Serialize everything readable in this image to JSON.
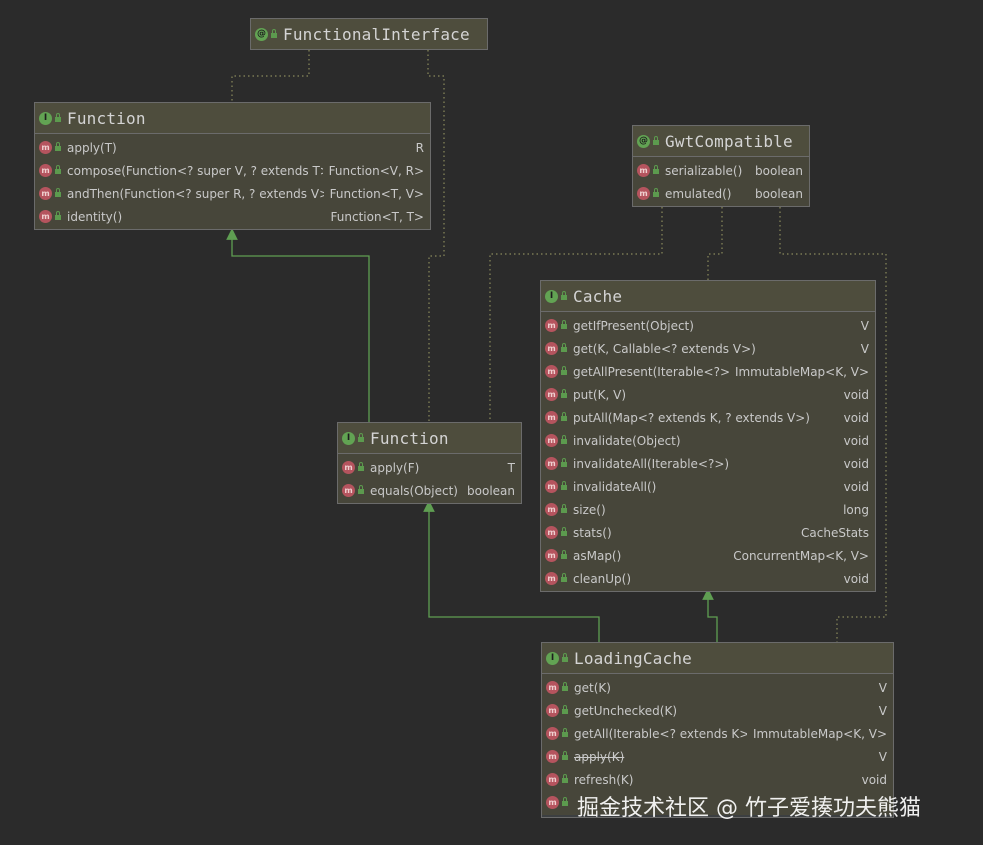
{
  "boxes": {
    "functional_interface": {
      "title": "FunctionalInterface",
      "kind": "annotation",
      "members": []
    },
    "function_top": {
      "title": "Function",
      "kind": "interface",
      "members": [
        {
          "name": "apply(T)",
          "type": "R"
        },
        {
          "name": "compose(Function<? super V, ? extends T>)",
          "type": "Function<V, R>"
        },
        {
          "name": "andThen(Function<? super R, ? extends V>)",
          "type": "Function<T, V>"
        },
        {
          "name": "identity()",
          "type": "Function<T, T>"
        }
      ]
    },
    "gwt_compatible": {
      "title": "GwtCompatible",
      "kind": "annotation",
      "members": [
        {
          "name": "serializable()",
          "type": "boolean"
        },
        {
          "name": "emulated()",
          "type": "boolean"
        }
      ]
    },
    "cache": {
      "title": "Cache",
      "kind": "interface",
      "members": [
        {
          "name": "getIfPresent(Object)",
          "type": "V"
        },
        {
          "name": "get(K, Callable<? extends V>)",
          "type": "V"
        },
        {
          "name": "getAllPresent(Iterable<?>)",
          "type": "ImmutableMap<K, V>"
        },
        {
          "name": "put(K, V)",
          "type": "void"
        },
        {
          "name": "putAll(Map<? extends K, ? extends V>)",
          "type": "void"
        },
        {
          "name": "invalidate(Object)",
          "type": "void"
        },
        {
          "name": "invalidateAll(Iterable<?>)",
          "type": "void"
        },
        {
          "name": "invalidateAll()",
          "type": "void"
        },
        {
          "name": "size()",
          "type": "long"
        },
        {
          "name": "stats()",
          "type": "CacheStats"
        },
        {
          "name": "asMap()",
          "type": "ConcurrentMap<K, V>"
        },
        {
          "name": "cleanUp()",
          "type": "void"
        }
      ]
    },
    "function_mid": {
      "title": "Function",
      "kind": "interface",
      "members": [
        {
          "name": "apply(F)",
          "type": "T"
        },
        {
          "name": "equals(Object)",
          "type": "boolean"
        }
      ]
    },
    "loading_cache": {
      "title": "LoadingCache",
      "kind": "interface",
      "members": [
        {
          "name": "get(K)",
          "type": "V"
        },
        {
          "name": "getUnchecked(K)",
          "type": "V"
        },
        {
          "name": "getAll(Iterable<? extends K>)",
          "type": "ImmutableMap<K, V>"
        },
        {
          "name": "apply(K)",
          "type": "V",
          "deprecated": true
        },
        {
          "name": "refresh(K)",
          "type": "void"
        },
        {
          "name": "",
          "type": ""
        }
      ]
    }
  },
  "badges": {
    "interface": "I",
    "annotation": "@",
    "method": "m"
  },
  "colors": {
    "background": "#2b2b2b",
    "header": "#4e4d3d",
    "body": "#47463a",
    "extends_arrow": "#5f9e52",
    "annotation_link": "#8a8a5c"
  },
  "watermark": "掘金技术社区 @ 竹子爱揍功夫熊猫"
}
